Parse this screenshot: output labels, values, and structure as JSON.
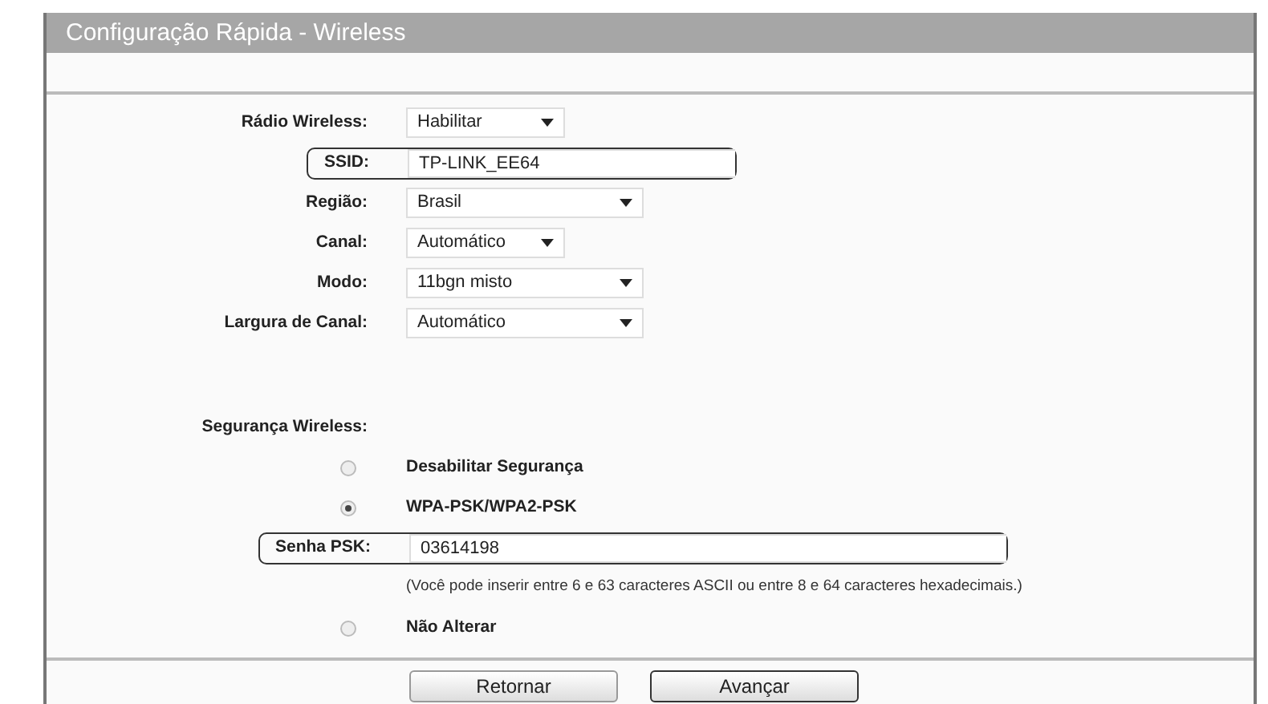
{
  "title": "Configuração Rápida - Wireless",
  "fields": [
    {
      "kind": "select",
      "label": "Rádio Wireless:",
      "value": "Habilitar",
      "highlighted": false
    },
    {
      "kind": "text",
      "label": "SSID:",
      "value": "TP-LINK_EE64",
      "highlighted": true
    },
    {
      "kind": "wideselect",
      "label": "Região:",
      "value": "Brasil",
      "highlighted": false
    },
    {
      "kind": "select",
      "label": "Canal:",
      "value": "Automático",
      "highlighted": false
    },
    {
      "kind": "wideselect",
      "label": "Modo:",
      "value": "11bgn misto",
      "highlighted": false
    },
    {
      "kind": "wideselect",
      "label": "Largura de Canal:",
      "value": "Automático",
      "highlighted": false
    }
  ],
  "security": {
    "label": "Segurança Wireless:",
    "items": [
      {
        "kind": "radio",
        "label": "Desabilitar Segurança",
        "selected": false
      },
      {
        "kind": "radio",
        "label": "WPA-PSK/WPA2-PSK",
        "selected": true
      },
      {
        "kind": "text",
        "label": "Senha PSK:",
        "value": "03614198",
        "highlighted": true
      },
      {
        "kind": "hint",
        "text": "(Você pode inserir entre 6 e 63 caracteres ASCII ou entre 8 e 64 caracteres hexadecimais.)"
      },
      {
        "kind": "radio",
        "label": "Não Alterar",
        "selected": false
      }
    ]
  },
  "buttons": [
    {
      "label": "Retornar",
      "emphasized": false
    },
    {
      "label": "Avançar",
      "emphasized": true
    }
  ]
}
